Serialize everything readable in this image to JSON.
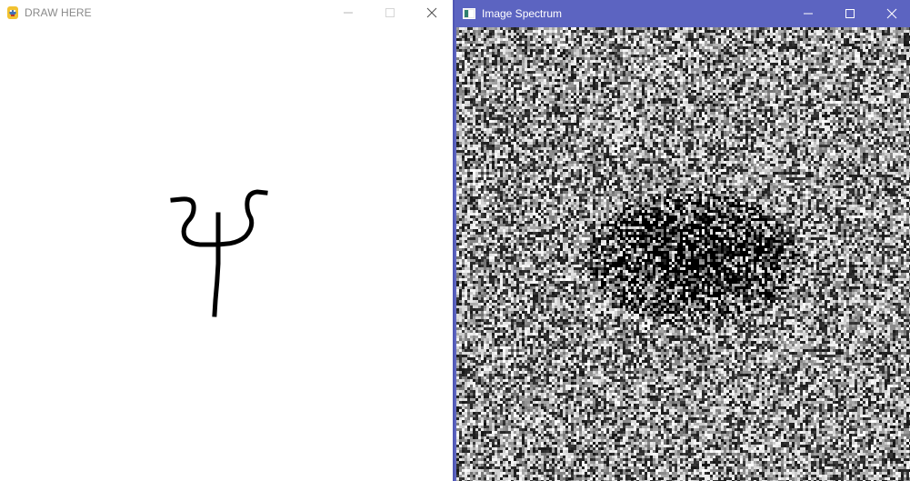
{
  "left_window": {
    "title": "DRAW HERE",
    "app_icon": "python-snake-icon",
    "controls": [
      "minimize-icon",
      "maximize-icon",
      "close-icon"
    ],
    "canvas": {
      "drawing": "hand-drawn trident stroke",
      "stroke_color": "#000000",
      "background": "#ffffff"
    }
  },
  "right_window": {
    "title": "Image Spectrum",
    "app_icon": "image-window-icon",
    "controls": [
      "minimize-icon",
      "maximize-icon",
      "close-icon"
    ],
    "titlebar_color": "#5c64c1",
    "image": {
      "content": "noisy grayscale Fourier spectrum with dark cluster at center"
    }
  }
}
